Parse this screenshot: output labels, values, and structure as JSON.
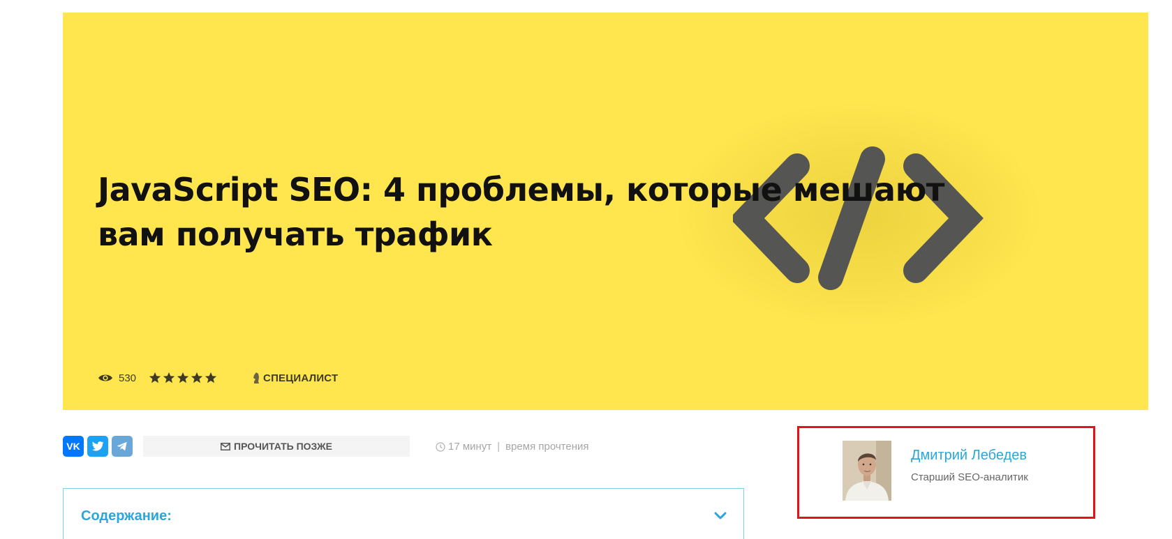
{
  "hero": {
    "title": "JavaScript SEO: 4 проблемы, которые мешают вам получать трафик",
    "views": "530",
    "rating_stars": 5,
    "level": "СПЕЦИАЛИСТ",
    "background_color": "#ffe64f",
    "image_icon": "code-brackets-icon"
  },
  "share": {
    "buttons": [
      {
        "name": "vk",
        "label": "VK"
      },
      {
        "name": "twitter",
        "label": ""
      },
      {
        "name": "telegram",
        "label": ""
      }
    ],
    "read_later": "ПРОЧИТАТЬ ПОЗЖЕ",
    "read_time_value": "17 минут",
    "read_time_label": "время прочтения"
  },
  "contents": {
    "title": "Содержание:"
  },
  "author": {
    "name": "Дмитрий Лебедев",
    "role": "Старший SEO-аналитик"
  },
  "colors": {
    "accent": "#2aa6d9",
    "highlight_border": "#e5121c",
    "vk": "#0077ff",
    "twitter": "#1da1f2",
    "telegram": "#69a7d9"
  }
}
